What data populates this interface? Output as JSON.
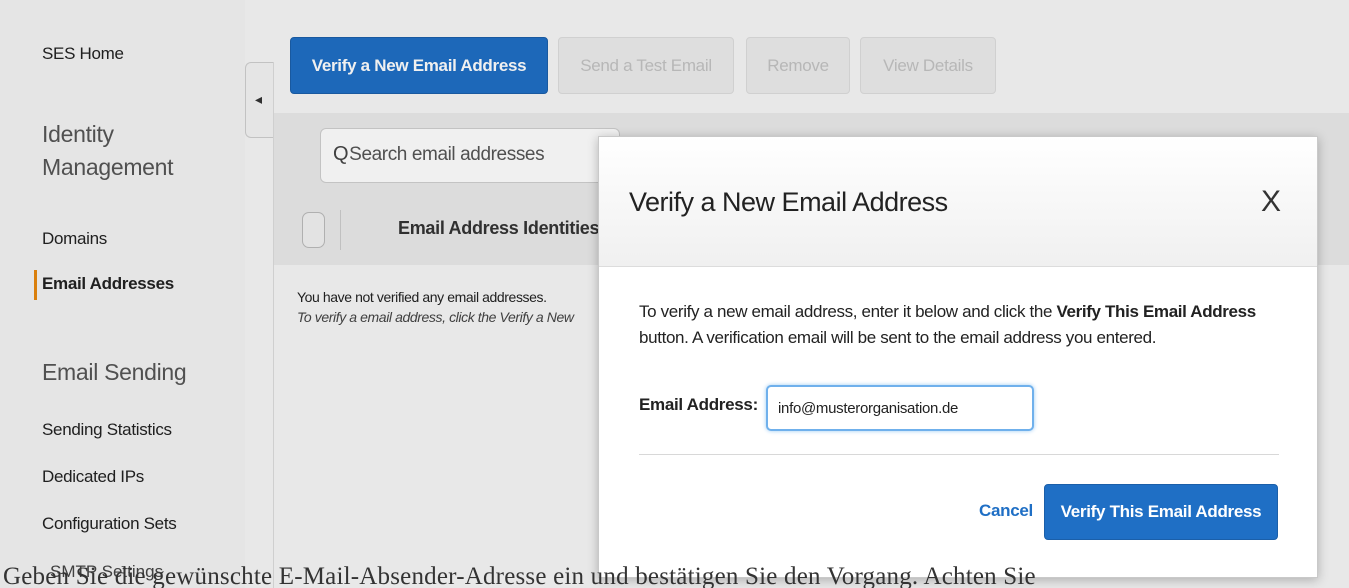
{
  "sidebar": {
    "ses_home": "SES Home",
    "identity_heading_line1": "Identity",
    "identity_heading_line2": "Management",
    "domains": "Domains",
    "email_addresses": "Email Addresses",
    "email_sending_heading": "Email Sending",
    "sending_statistics": "Sending Statistics",
    "dedicated_ips": "Dedicated IPs",
    "configuration_sets": "Configuration Sets",
    "smtp_settings": "SMTP Settings",
    "collapse_glyph": "◂"
  },
  "toolbar": {
    "verify_new": "Verify a New Email Address",
    "send_test": "Send a Test Email",
    "remove": "Remove",
    "view_details": "View Details"
  },
  "search": {
    "icon_glyph": "Q",
    "placeholder": "Search email addresses"
  },
  "table": {
    "column_header": "Email Address Identities",
    "empty_message": "You have not verified any email addresses.",
    "empty_hint": "To verify a email address, click the Verify a New"
  },
  "modal": {
    "title": "Verify a New Email Address",
    "close_glyph": "X",
    "desc_part1": "To verify a new email address, enter it below and click the ",
    "desc_bold": "Verify This Email Address",
    "desc_part2": " button. A verification email will be sent to the email address you entered.",
    "email_label": "Email Address:",
    "email_value": "info@musterorganisation.de",
    "cancel": "Cancel",
    "verify_button": "Verify This Email Address"
  },
  "caption": "Geben Sie die gewünschte E-Mail-Absender-Adresse ein und bestätigen Sie den Vorgang. Achten Sie"
}
